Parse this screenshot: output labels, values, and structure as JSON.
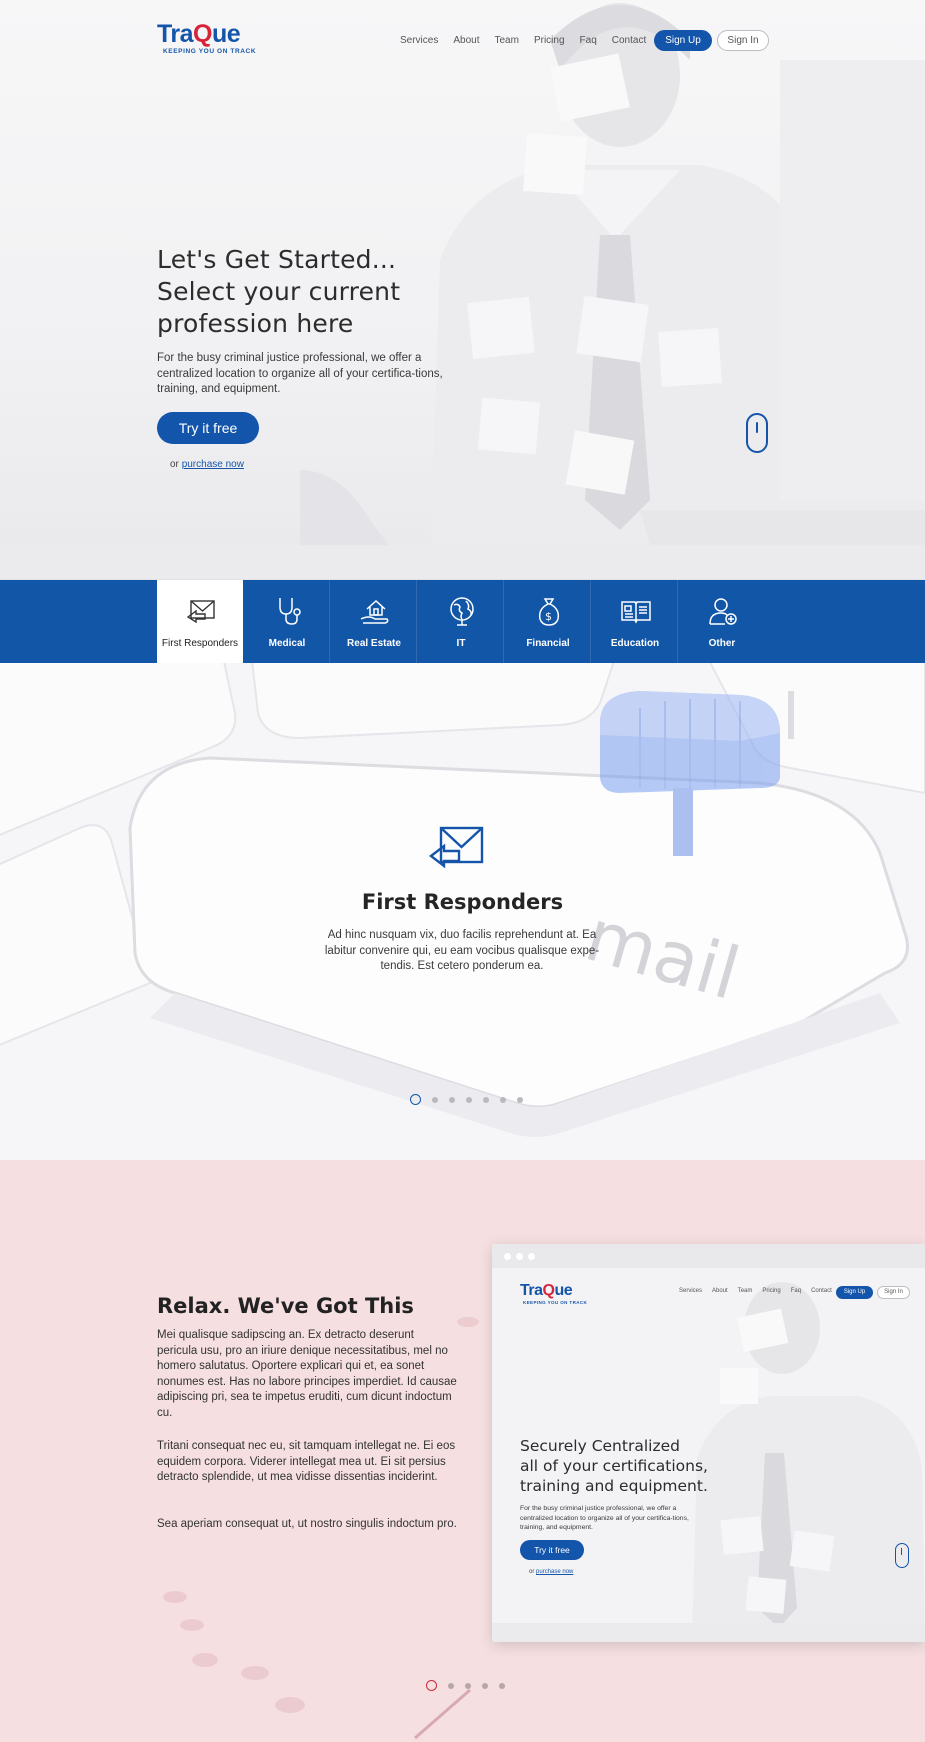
{
  "brand": {
    "name_before": "Tra",
    "name_mark": "Q",
    "name_after": "ue",
    "tagline": "KEEPING YOU ON TRACK"
  },
  "nav": {
    "items": [
      "Services",
      "About",
      "Team",
      "Pricing",
      "Faq",
      "Contact"
    ],
    "signup": "Sign Up",
    "signin": "Sign In"
  },
  "hero": {
    "title_lines": [
      "Let's Get Started...",
      "Select your current",
      "profession here"
    ],
    "text": "For the busy criminal justice professional, we offer a centralized location to organize all of your certifica-tions, training, and equipment.",
    "cta": "Try it free",
    "purchase_prefix": "or",
    "purchase_link": "purchase now"
  },
  "professions": {
    "active_index": 0,
    "items": [
      {
        "label": "First Responders",
        "icon": "mail-arrow-icon"
      },
      {
        "label": "Medical",
        "icon": "stethoscope-icon"
      },
      {
        "label": "Real Estate",
        "icon": "house-hand-icon"
      },
      {
        "label": "IT",
        "icon": "globe-icon"
      },
      {
        "label": "Financial",
        "icon": "money-bag-icon"
      },
      {
        "label": "Education",
        "icon": "open-book-icon"
      },
      {
        "label": "Other",
        "icon": "user-plus-icon"
      }
    ]
  },
  "feature": {
    "icon": "mail-arrow-icon",
    "title": "First Responders",
    "text": "Ad hinc nusquam vix, duo facilis reprehendunt at. Ea labitur convenire qui, eu eam vocibus qualisque expe-tendis. Est cetero ponderum ea.",
    "background_word": "mail",
    "slider": {
      "count": 7,
      "active": 0
    }
  },
  "relax": {
    "title": "Relax.  We've Got This",
    "paragraphs": [
      "Mei qualisque sadipscing an. Ex detracto deserunt pericula usu, pro an iriure denique necessitatibus, mel no homero salutatus. Oportere explicari qui et, ea sonet nonumes est. Has no labore principes imperdiet. Id causae adipiscing pri, sea te impetus eruditi, cum dicunt indoctum cu.",
      "Tritani consequat nec eu, sit tamquam intellegat ne. Ei eos equidem corpora. Viderer intellegat mea ut. Ei sit persius detracto splendide, ut mea vidisse dissentias inciderint.",
      "Sea aperiam consequat ut, ut nostro singulis indoctum pro."
    ],
    "slider": {
      "count": 5,
      "active": 0
    },
    "mockup": {
      "nav_items": [
        "Services",
        "About",
        "Team",
        "Pricing",
        "Faq",
        "Contact"
      ],
      "signup": "Sign Up",
      "signin": "Sign In",
      "title_lines": [
        "Securely Centralized",
        "all of your certifications,",
        "training and equipment."
      ],
      "text": "For the busy criminal justice professional, we offer a centralized location to organize all of your certifica-tions, training, and equipment.",
      "cta": "Try it free",
      "purchase_prefix": "or",
      "purchase_link": "purchase now"
    }
  },
  "colors": {
    "primary": "#1256a8",
    "accent": "#d6243a",
    "relax_bg": "#f5dfe1"
  }
}
